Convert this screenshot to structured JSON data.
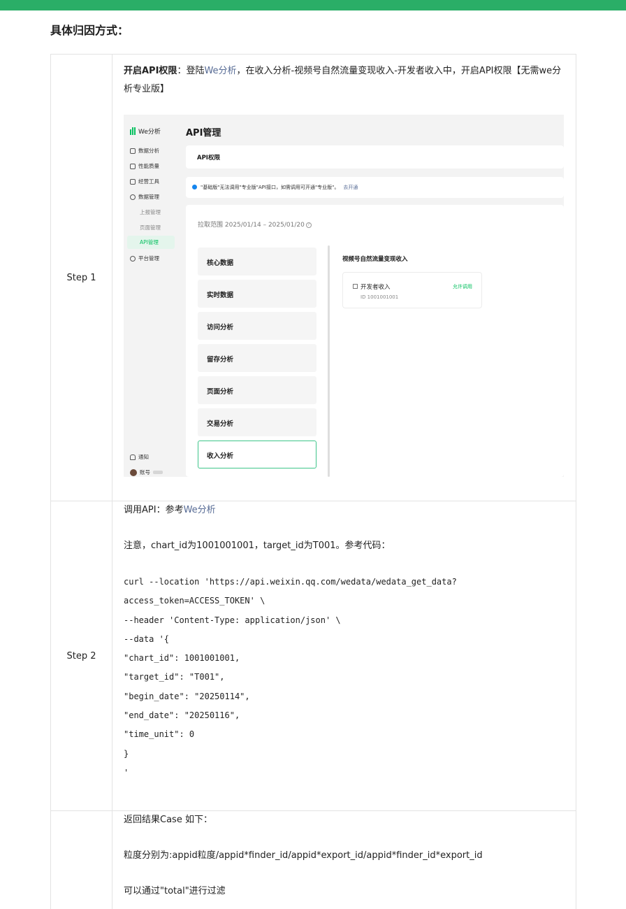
{
  "section_title": "具体归因方式：",
  "step1": {
    "label": "Step 1",
    "bold_prefix": "开启API权限",
    "colon": "：登陆",
    "link": "We分析",
    "text": "，在收入分析-视频号自然流量变现收入-开发者收入中，开启API权限【无需we分析专业版】",
    "mock": {
      "brand": "We分析",
      "sidebar": [
        "数据分析",
        "性能质量",
        "经营工具",
        "数据管理"
      ],
      "sidebar_sub": [
        "上报管理",
        "页面管理",
        "API管理"
      ],
      "sidebar_platform": "平台管理",
      "notify": "通知",
      "account": "账号",
      "page_title": "API管理",
      "card_title": "API权限",
      "notice_text": "\"基础版\"无法调用\"专业版\"API接口，如需调用可开通\"专业版\"。",
      "notice_link": "去开通",
      "range": "拉取范围 2025/01/14 – 2025/01/20",
      "menu": [
        "核心数据",
        "实时数据",
        "访问分析",
        "留存分析",
        "页面分析",
        "交易分析",
        "收入分析"
      ],
      "right_head": "视频号自然流量变现收入",
      "dev_name": "开发者收入",
      "dev_status": "允许调用",
      "dev_id": "ID 1001001001"
    }
  },
  "step2": {
    "label": "Step 2",
    "line1_prefix": "调用API：参考",
    "line1_link": "We分析",
    "line2": "注意，chart_id为1001001001，target_id为T001。参考代码：",
    "code": [
      "curl --location 'https://api.weixin.qq.com/wedata/wedata_get_data?",
      "access_token=ACCESS_TOKEN' \\",
      "--header 'Content-Type: application/json' \\",
      "--data '{",
      "\"chart_id\": 1001001001,",
      "\"target_id\": \"T001\",",
      "\"begin_date\": \"20250114\",",
      "\"end_date\": \"20250116\",",
      "\"time_unit\": 0",
      "}",
      "'"
    ]
  },
  "step3": {
    "line1": "返回结果Case 如下：",
    "line2": "粒度分别为:appid粒度/appid*finder_id/appid*export_id/appid*finder_id*export_id",
    "line3": "可以通过\"total\"进行过滤"
  },
  "colors": {
    "brand_green": "#2aae67",
    "link": "#576b95",
    "wechat_green": "#07c160"
  }
}
